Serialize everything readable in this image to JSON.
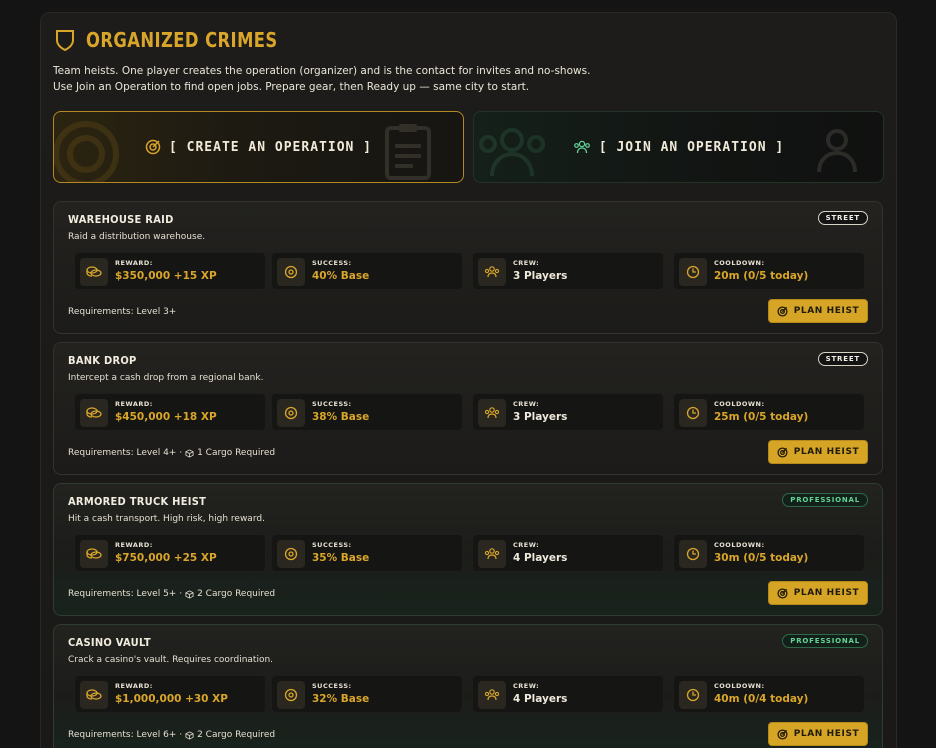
{
  "header": {
    "title": "ORGANIZED CRIMES",
    "description": "Team heists. One player creates the operation (organizer) and is the contact for invites and no-shows. Use Join an Operation to find open jobs. Prepare gear, then Ready up — same city to start."
  },
  "actions": {
    "create_label": "[ CREATE AN OPERATION ]",
    "join_label": "[ JOIN AN OPERATION ]"
  },
  "labels": {
    "reward": "REWARD:",
    "success": "SUCCESS:",
    "crew": "CREW:",
    "cooldown": "COOLDOWN:",
    "plan": "PLAN HEIST"
  },
  "colors": {
    "accent": "#d9a62a",
    "professional": "#64d397"
  },
  "heists": [
    {
      "title": "WAREHOUSE RAID",
      "subtitle": "Raid a distribution warehouse.",
      "badge": "STREET",
      "reward": "$350,000 +15 XP",
      "success": "40% Base",
      "crew": "3 Players",
      "cooldown": "20m (0/5 today)",
      "requirements": "Requirements: Level 3+",
      "cargo": ""
    },
    {
      "title": "BANK DROP",
      "subtitle": "Intercept a cash drop from a regional bank.",
      "badge": "STREET",
      "reward": "$450,000 +18 XP",
      "success": "38% Base",
      "crew": "3 Players",
      "cooldown": "25m (0/5 today)",
      "requirements": "Requirements: Level 4+ ·",
      "cargo": "1 Cargo Required"
    },
    {
      "title": "ARMORED TRUCK HEIST",
      "subtitle": "Hit a cash transport. High risk, high reward.",
      "badge": "PROFESSIONAL",
      "reward": "$750,000 +25 XP",
      "success": "35% Base",
      "crew": "4 Players",
      "cooldown": "30m (0/5 today)",
      "requirements": "Requirements: Level 5+ ·",
      "cargo": "2 Cargo Required"
    },
    {
      "title": "CASINO VAULT",
      "subtitle": "Crack a casino's vault. Requires coordination.",
      "badge": "PROFESSIONAL",
      "reward": "$1,000,000 +30 XP",
      "success": "32% Base",
      "crew": "4 Players",
      "cooldown": "40m (0/4 today)",
      "requirements": "Requirements: Level 6+ ·",
      "cargo": "2 Cargo Required"
    }
  ]
}
